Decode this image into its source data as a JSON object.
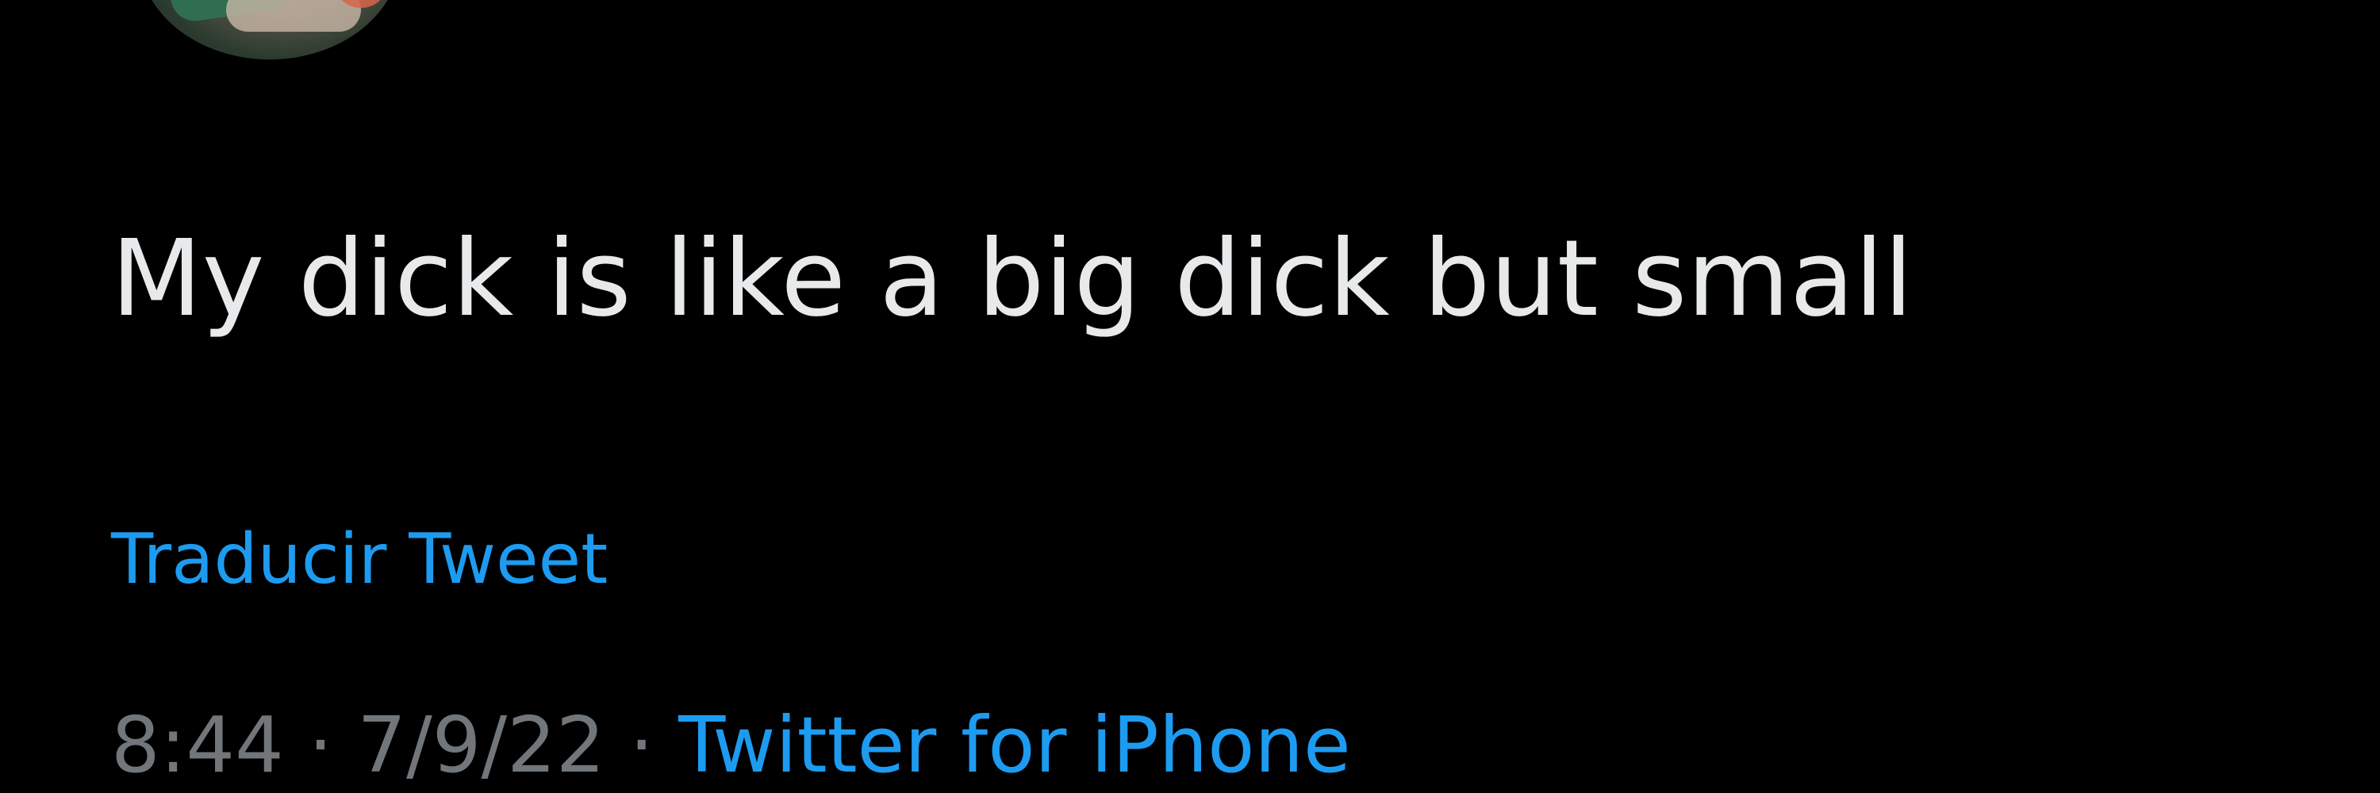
{
  "tweet": {
    "text": "My dick is like a big dick but small",
    "translate_label": "Traducir Tweet",
    "time": "8:44",
    "separator": "·",
    "date": "7/9/22",
    "source": "Twitter for iPhone"
  },
  "colors": {
    "background": "#000000",
    "text": "#e7e9ea",
    "link": "#1d9bf0",
    "muted": "#71767b"
  }
}
